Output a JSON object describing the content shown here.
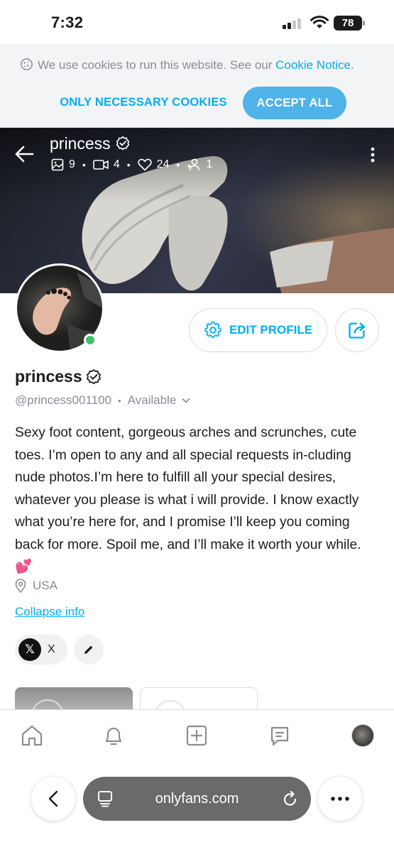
{
  "status_bar": {
    "time": "7:32",
    "battery": "78"
  },
  "cookie_banner": {
    "text": "We use cookies to run this website. See our",
    "link": "Cookie Notice",
    "suffix": ".",
    "necessary_label": "ONLY NECESSARY COOKIES",
    "accept_label": "ACCEPT ALL"
  },
  "cover": {
    "name": "princess",
    "stats": {
      "photos": "9",
      "videos": "4",
      "likes": "24",
      "subscribers": "1"
    }
  },
  "profile": {
    "name": "princess",
    "handle": "@princess001100",
    "separator": "•",
    "availability": "Available",
    "edit_label": "EDIT PROFILE",
    "bio": "Sexy foot content, gorgeous arches and scrunches, cute toes. I’m open to any and all special requests in-cluding nude photos.I’m here to fulfill all your special desires, whatever you please is what i will provide. I know exactly what you’re here for, and I promise I’ll keep you coming back for more. Spoil me, and I’ll make it worth your while. 💕",
    "location": "USA",
    "collapse_label": "Collapse info",
    "social_x_label": "X"
  },
  "browser": {
    "url": "onlyfans.com"
  },
  "colors": {
    "accent": "#00aff0",
    "online": "#3ac26d"
  }
}
